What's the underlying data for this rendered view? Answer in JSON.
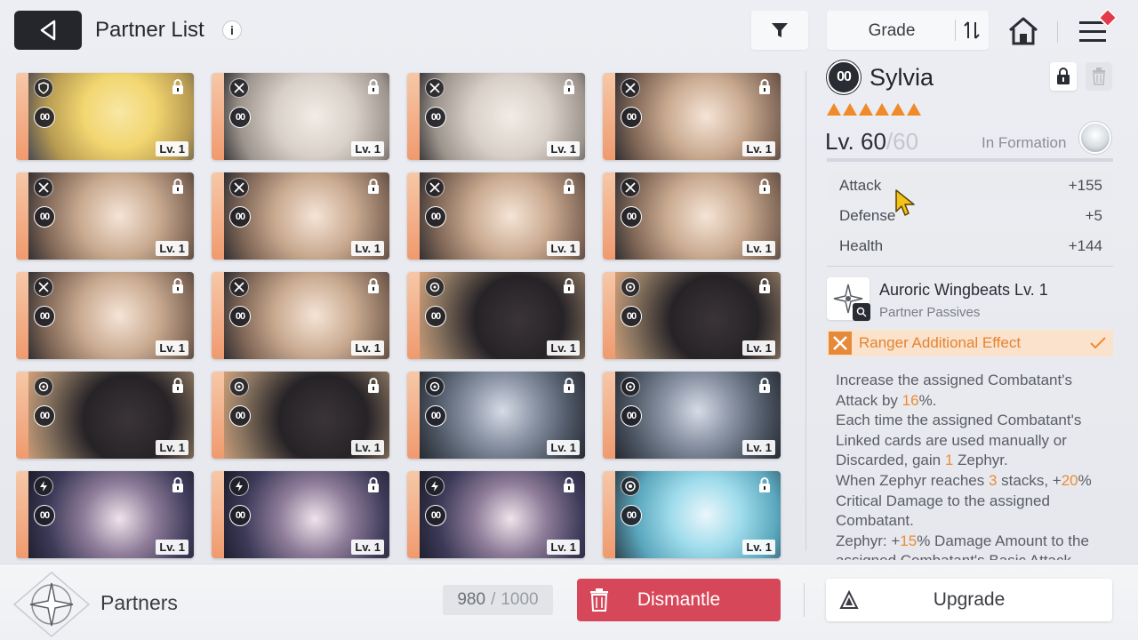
{
  "header": {
    "title": "Partner List",
    "info_icon": "i",
    "sort": {
      "label": "Grade"
    }
  },
  "grid": {
    "cards": [
      {
        "art": "blonde",
        "class_icon": "shield",
        "grade": "00",
        "level": "Lv. 1"
      },
      {
        "art": "silver",
        "class_icon": "swords",
        "grade": "00",
        "level": "Lv. 1"
      },
      {
        "art": "silver",
        "class_icon": "swords",
        "grade": "00",
        "level": "Lv. 1"
      },
      {
        "art": "brown",
        "class_icon": "swords",
        "grade": "00",
        "level": "Lv. 1"
      },
      {
        "art": "brown",
        "class_icon": "swords",
        "grade": "00",
        "level": "Lv. 1"
      },
      {
        "art": "brown",
        "class_icon": "swords",
        "grade": "00",
        "level": "Lv. 1"
      },
      {
        "art": "brown",
        "class_icon": "swords",
        "grade": "00",
        "level": "Lv. 1"
      },
      {
        "art": "brown",
        "class_icon": "swords",
        "grade": "00",
        "level": "Lv. 1"
      },
      {
        "art": "brown",
        "class_icon": "swords",
        "grade": "00",
        "level": "Lv. 1"
      },
      {
        "art": "brown",
        "class_icon": "swords",
        "grade": "00",
        "level": "Lv. 1"
      },
      {
        "art": "cat",
        "class_icon": "target",
        "grade": "00",
        "level": "Lv. 1"
      },
      {
        "art": "cat",
        "class_icon": "target",
        "grade": "00",
        "level": "Lv. 1"
      },
      {
        "art": "cat",
        "class_icon": "target",
        "grade": "00",
        "level": "Lv. 1"
      },
      {
        "art": "cat",
        "class_icon": "target",
        "grade": "00",
        "level": "Lv. 1"
      },
      {
        "art": "mech",
        "class_icon": "target",
        "grade": "00",
        "level": "Lv. 1"
      },
      {
        "art": "mech",
        "class_icon": "target",
        "grade": "00",
        "level": "Lv. 1"
      },
      {
        "art": "dark",
        "class_icon": "bolt",
        "grade": "00",
        "level": "Lv. 1"
      },
      {
        "art": "dark",
        "class_icon": "bolt",
        "grade": "00",
        "level": "Lv. 1"
      },
      {
        "art": "dark",
        "class_icon": "bolt",
        "grade": "00",
        "level": "Lv. 1"
      },
      {
        "art": "blue",
        "class_icon": "ring",
        "grade": "00",
        "level": "Lv. 1"
      }
    ]
  },
  "detail": {
    "grade": "00",
    "name": "Sylvia",
    "stars": 6,
    "level_prefix": "Lv. ",
    "level": "60",
    "level_max": "/60",
    "formation_label": "In Formation",
    "stats": [
      {
        "label": "Attack",
        "value": "+155"
      },
      {
        "label": "Defense",
        "value": "+5"
      },
      {
        "label": "Health",
        "value": "+144"
      }
    ],
    "passive": {
      "name": "Auroric Wingbeats Lv. 1",
      "type": "Partner Passives"
    },
    "effect": {
      "label": "Ranger Additional Effect"
    },
    "description": [
      [
        {
          "t": "Increase the assigned Combatant's Attack by "
        },
        {
          "t": "16",
          "hl": true
        },
        {
          "t": "%."
        }
      ],
      [
        {
          "t": "Each time the assigned Combatant's Linked cards are used manually or Discarded, gain "
        },
        {
          "t": "1",
          "hl": true
        },
        {
          "t": " Zephyr."
        }
      ],
      [
        {
          "t": "When Zephyr reaches "
        },
        {
          "t": "3",
          "hl": true
        },
        {
          "t": " stacks, +"
        },
        {
          "t": "20",
          "hl": true
        },
        {
          "t": "% Critical Damage to the assigned Combatant."
        }
      ],
      [
        {
          "t": "Zephyr: +"
        },
        {
          "t": "15",
          "hl": true
        },
        {
          "t": "% Damage Amount to the assigned Combatant's Basic Attack."
        }
      ]
    ],
    "colors": {
      "accent": "#f08a2b",
      "effect_bg": "#fbe2cc"
    }
  },
  "footer": {
    "partners_label": "Partners",
    "capacity_current": "980",
    "capacity_sep": "/",
    "capacity_max": "1000",
    "dismantle_label": "Dismantle",
    "upgrade_label": "Upgrade",
    "colors": {
      "dismantle": "#d7475a"
    }
  }
}
